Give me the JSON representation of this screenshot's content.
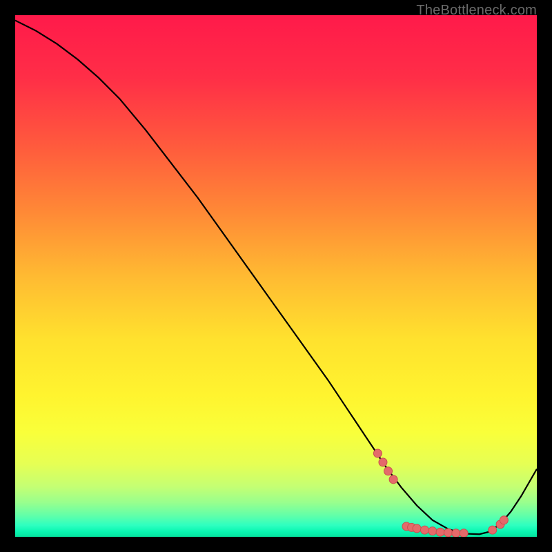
{
  "watermark": "TheBottleneck.com",
  "colors": {
    "curve": "#000000",
    "marker_fill": "#e46a6a",
    "marker_stroke": "#c94f4f"
  },
  "gradient_stops": [
    {
      "offset": 0.0,
      "color": "#ff1a4a"
    },
    {
      "offset": 0.12,
      "color": "#ff2e47"
    },
    {
      "offset": 0.25,
      "color": "#ff5a3d"
    },
    {
      "offset": 0.38,
      "color": "#ff8a36"
    },
    {
      "offset": 0.5,
      "color": "#ffba32"
    },
    {
      "offset": 0.62,
      "color": "#ffe12e"
    },
    {
      "offset": 0.73,
      "color": "#fff42f"
    },
    {
      "offset": 0.8,
      "color": "#f9ff3a"
    },
    {
      "offset": 0.86,
      "color": "#e6ff54"
    },
    {
      "offset": 0.905,
      "color": "#c3ff74"
    },
    {
      "offset": 0.935,
      "color": "#97ff8e"
    },
    {
      "offset": 0.96,
      "color": "#5fffaa"
    },
    {
      "offset": 0.978,
      "color": "#2effc0"
    },
    {
      "offset": 0.99,
      "color": "#09f7b2"
    },
    {
      "offset": 1.0,
      "color": "#06e39e"
    }
  ],
  "chart_data": {
    "type": "line",
    "title": "",
    "xlabel": "",
    "ylabel": "",
    "xlim": [
      0,
      100
    ],
    "ylim": [
      0,
      100
    ],
    "series": [
      {
        "name": "bottleneck-curve",
        "x": [
          0,
          4,
          8,
          12,
          16,
          20,
          25,
          30,
          35,
          40,
          45,
          50,
          55,
          60,
          65,
          68,
          71,
          74,
          77,
          80,
          83,
          86,
          89,
          91,
          93,
          95,
          97,
          100
        ],
        "y": [
          99,
          97,
          94.5,
          91.5,
          88,
          84,
          78,
          71.5,
          65,
          58,
          51,
          44,
          37,
          30,
          22.5,
          18,
          13.5,
          9.5,
          6,
          3.2,
          1.5,
          0.6,
          0.5,
          1.0,
          2.5,
          4.8,
          7.8,
          13
        ]
      }
    ],
    "markers": {
      "series": "bottleneck-curve",
      "points": [
        {
          "x": 69.5,
          "y": 16.0
        },
        {
          "x": 70.5,
          "y": 14.3
        },
        {
          "x": 71.5,
          "y": 12.6
        },
        {
          "x": 72.5,
          "y": 11.0
        },
        {
          "x": 75.0,
          "y": 2.0
        },
        {
          "x": 76.0,
          "y": 1.8
        },
        {
          "x": 77.0,
          "y": 1.6
        },
        {
          "x": 78.5,
          "y": 1.3
        },
        {
          "x": 80.0,
          "y": 1.1
        },
        {
          "x": 81.5,
          "y": 0.9
        },
        {
          "x": 83.0,
          "y": 0.8
        },
        {
          "x": 84.5,
          "y": 0.7
        },
        {
          "x": 86.0,
          "y": 0.7
        },
        {
          "x": 91.5,
          "y": 1.3
        },
        {
          "x": 93.0,
          "y": 2.4
        },
        {
          "x": 93.7,
          "y": 3.2
        }
      ],
      "radius": 6
    }
  }
}
